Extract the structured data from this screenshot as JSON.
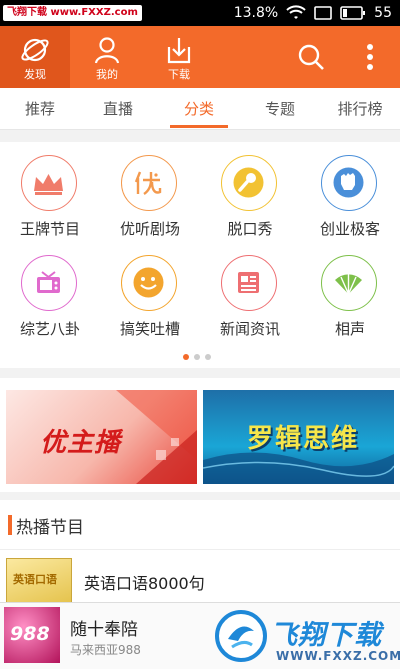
{
  "statusbar": {
    "watermark": "飞翔下载 www.FXXZ.com",
    "battery_percent": "13.8%",
    "signal": "55"
  },
  "topbar": {
    "nav": [
      {
        "label": "发现",
        "icon": "planet-icon",
        "active": true
      },
      {
        "label": "我的",
        "icon": "user-icon",
        "active": false
      },
      {
        "label": "下载",
        "icon": "download-icon",
        "active": false
      }
    ],
    "search_icon": "search-icon",
    "more_icon": "more-vertical-icon"
  },
  "tabs": [
    {
      "label": "推荐",
      "active": false
    },
    {
      "label": "直播",
      "active": false
    },
    {
      "label": "分类",
      "active": true
    },
    {
      "label": "专题",
      "active": false
    },
    {
      "label": "排行榜",
      "active": false
    }
  ],
  "categories": [
    {
      "label": "王牌节目",
      "icon": "crown-icon",
      "color": "#f07c6a"
    },
    {
      "label": "优听剧场",
      "icon": "you-char-icon",
      "color": "#f3994d"
    },
    {
      "label": "脱口秀",
      "icon": "microphone-icon",
      "color": "#f2c233"
    },
    {
      "label": "创业极客",
      "icon": "fist-icon",
      "color": "#4a8fd9"
    },
    {
      "label": "综艺八卦",
      "icon": "tv-icon",
      "color": "#e06acd"
    },
    {
      "label": "搞笑吐槽",
      "icon": "smile-icon",
      "color": "#f3a52e"
    },
    {
      "label": "新闻资讯",
      "icon": "newspaper-icon",
      "color": "#ee6f72"
    },
    {
      "label": "相声",
      "icon": "fan-icon",
      "color": "#7ec04a"
    }
  ],
  "pager": {
    "count": 3,
    "active": 0
  },
  "banners": [
    {
      "text": "优主播"
    },
    {
      "text": "罗辑思维"
    }
  ],
  "hot": {
    "title": "热播节目",
    "items": [
      {
        "name": "英语口语8000句",
        "thumb_text": "英语口语"
      }
    ]
  },
  "player": {
    "art_text": "988",
    "title": "随十奉陪",
    "subtitle": "马来西亚988",
    "brand_text": "飞翔下载",
    "brand_url": "WWW.FXXZ.COM"
  },
  "colors": {
    "accent": "#f36a2a",
    "accent_dark": "#e0561c"
  }
}
